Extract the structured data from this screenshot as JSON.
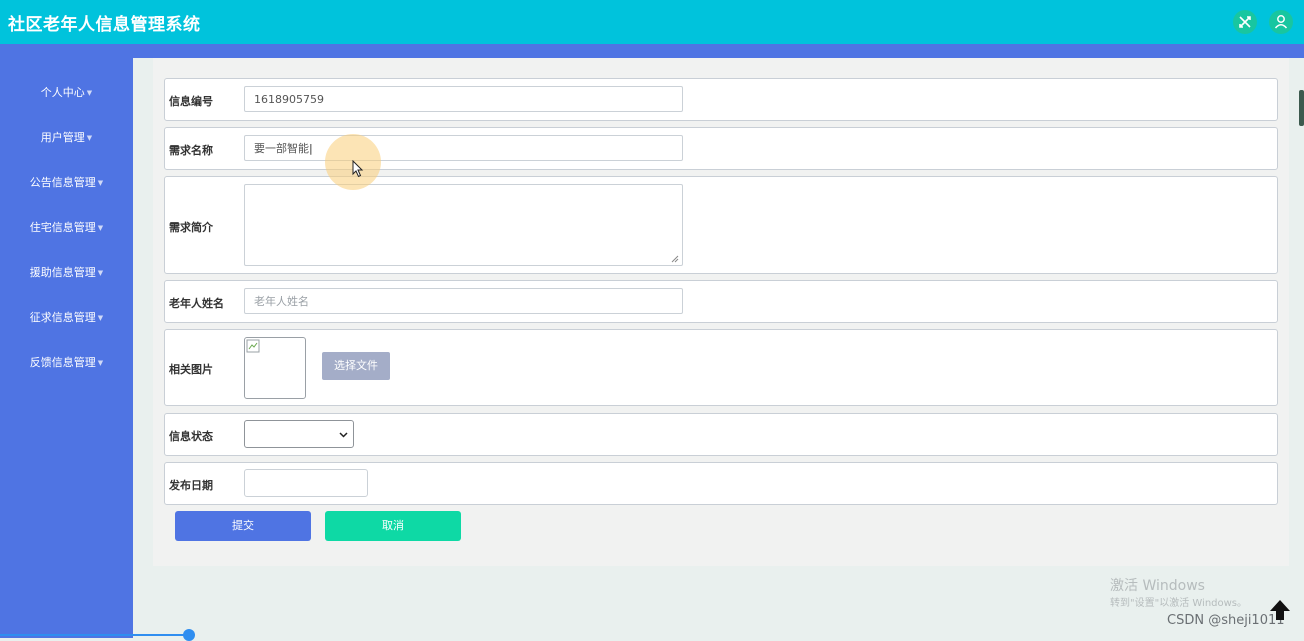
{
  "header": {
    "title": "社区老年人信息管理系统",
    "icons": [
      "shuffle-icon",
      "user-icon"
    ]
  },
  "sidebar": {
    "items": [
      {
        "label": "个人中心"
      },
      {
        "label": "用户管理"
      },
      {
        "label": "公告信息管理"
      },
      {
        "label": "住宅信息管理"
      },
      {
        "label": "援助信息管理"
      },
      {
        "label": "征求信息管理"
      },
      {
        "label": "反馈信息管理"
      }
    ]
  },
  "form": {
    "info_id": {
      "label": "信息编号",
      "value": "1618905759"
    },
    "req_name": {
      "label": "需求名称",
      "value": "要一部智能"
    },
    "req_desc": {
      "label": "需求简介",
      "value": ""
    },
    "elder_name": {
      "label": "老年人姓名",
      "placeholder": "老年人姓名"
    },
    "image": {
      "label": "相关图片",
      "button": "选择文件"
    },
    "status": {
      "label": "信息状态",
      "value": ""
    },
    "date": {
      "label": "发布日期",
      "value": ""
    }
  },
  "actions": {
    "submit": "提交",
    "cancel": "取消"
  },
  "watermark": {
    "line1": "激活 Windows",
    "line2": "转到\"设置\"以激活 Windows。"
  },
  "credit": "CSDN @sheji1011",
  "colors": {
    "topbar": "#00c3dc",
    "sidebar": "#4f74e3",
    "submit": "#4f74e3",
    "cancel": "#0ed9a5"
  }
}
